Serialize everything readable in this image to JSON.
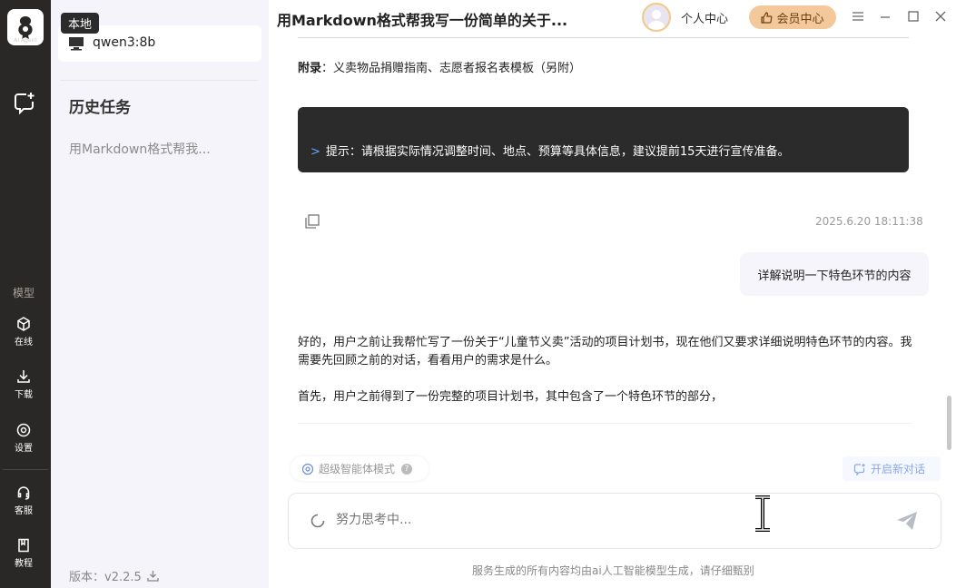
{
  "rail": {
    "logo_sub": "AI Agent",
    "model_label": "模型",
    "online": "在线",
    "download": "下载",
    "settings": "设置",
    "support": "客服",
    "tutorial": "教程"
  },
  "sidebar": {
    "tooltip": "本地",
    "model_name": "qwen3:8b",
    "history_title": "历史任务",
    "history_items": [
      "用Markdown格式帮我..."
    ],
    "version": "版本：v2.2.5"
  },
  "header": {
    "title": "用Markdown格式帮我写一份简单的关于...",
    "personal_center": "个人中心",
    "vip_center": "会员中心"
  },
  "chat": {
    "appendix_label": "附录",
    "appendix_text": "：义卖物品捐赠指南、志愿者报名表模板（另附）",
    "code_prefix": ">",
    "code_text": "提示：请根据实际情况调整时间、地点、预算等具体信息，建议提前15天进行宣传准备。",
    "timestamp": "2025.6.20 18:11:38",
    "user_message": "详解说明一下特色环节的内容",
    "answer_p1": "好的，用户之前让我帮忙写了一份关于“儿童节义卖”活动的项目计划书，现在他们又要求详细说明特色环节的内容。我需要先回顾之前的对话，看看用户的需求是什么。",
    "answer_p2": "首先，用户之前得到了一份完整的项目计划书，其中包含了一个特色环节的部分，"
  },
  "controls": {
    "mode_label": "超级智能体模式",
    "new_chat": "开启新对话",
    "input_placeholder": "努力思考中..."
  },
  "footer": {
    "note": "服务生成的所有内容均由ai人工智能模型生成，请仔细甄别"
  },
  "colors": {
    "rail_bg": "#2a2826",
    "sidebar_bg": "#f5f4fa",
    "vip_bg": "#f3c89a",
    "code_bg": "#2b2b2b",
    "accent_blue": "#6aa7ff"
  }
}
